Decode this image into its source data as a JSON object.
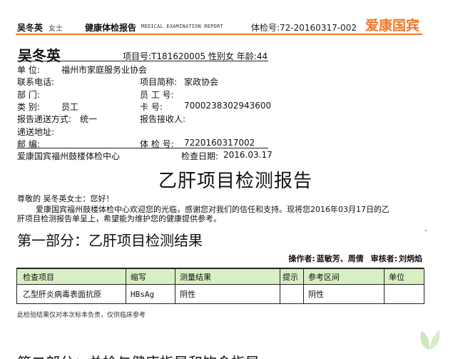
{
  "header": {
    "name": "吴冬英",
    "gender": "女士",
    "title": "健康体检报告",
    "title_en": "MEDICAL EXAMINATION REPORT",
    "exam_no_label": "体检号:",
    "exam_no": "72-20160317-002",
    "brand": "爱康国宾",
    "brand_color": "#f0772a"
  },
  "patient": {
    "name": "吴冬英",
    "project_no_label": "项目号:",
    "project_no": "T181620005",
    "gender_label": "性别",
    "gender": "女",
    "age_label": "年龄:",
    "age": "44",
    "unit_label": "单    位:",
    "unit": "福州市家庭服务业协会",
    "phone_label": "联系电话:",
    "phone": "",
    "project_short_label": "项目简称:",
    "project_short": "家政协会",
    "dept_label": "部    门:",
    "dept": "",
    "employee_no_label": "员 工 号:",
    "employee_no": "",
    "category_label": "类    别:",
    "category": "员工",
    "card_label": "卡      号:",
    "card": "7000238302943600",
    "delivery_label": "报告递送方式:",
    "delivery": "统一",
    "receiver_label": "报告接收人:",
    "receiver": "",
    "address_label": "递送地址:",
    "address": "",
    "postcode_label": "邮    编:",
    "postcode": "",
    "exam_no_label": "体 检 号:",
    "exam_no": "7220160317002",
    "center": "爱康国宾福州鼓楼体检中心",
    "exam_date_label": "检查日期:",
    "exam_date": "2016.03.17"
  },
  "report": {
    "title": "乙肝项目检测报告",
    "greeting": "尊敬的 吴冬英女士：您好！",
    "para_line1": "爱康国宾福州鼓楼体检中心欢迎您的光临，感谢您对我们的信任和支持。现将您2016年03月17日的乙",
    "para_line2": "肝项目检测报告单呈上，希望能为维护您的健康提供参考。",
    "section1": "第一部分：乙肝项目检测结果",
    "operator_label": "操作者:",
    "operators": "蓝敏芳、周倩",
    "reviewer_label": "审核者:",
    "reviewer": "刘炳焰",
    "table": {
      "headers": [
        "检查项目",
        "缩写",
        "测量结果",
        "提示",
        "参考区间",
        "单位"
      ],
      "rows": [
        [
          "乙型肝炎病毒表面抗原",
          "HBsAg",
          "阴性",
          "",
          "阴性",
          ""
        ]
      ]
    },
    "note": "此检验结果仅对本次标本负责，仅供临床参考",
    "section2": "第二部分：总检与健康指导和饮食指导"
  },
  "colors": {
    "table_header_bg": "#d8efc4",
    "leaf": "#b9dca0"
  }
}
